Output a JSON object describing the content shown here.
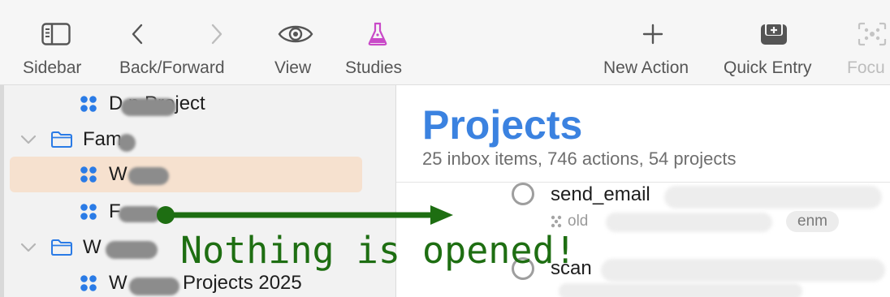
{
  "toolbar": {
    "items": [
      {
        "label": "Sidebar",
        "icon": "sidebar-icon"
      },
      {
        "label": "Back/Forward",
        "icon": "chevron-left-right-icon"
      },
      {
        "label": "View",
        "icon": "eye-icon"
      },
      {
        "label": "Studies",
        "icon": "flask-icon"
      },
      {
        "label": "New Action",
        "icon": "plus-icon"
      },
      {
        "label": "Quick Entry",
        "icon": "inbox-icon"
      },
      {
        "label": "Focu",
        "icon": "focus-icon"
      }
    ]
  },
  "sidebar": {
    "items": [
      {
        "label": "D      n Project",
        "type": "project"
      },
      {
        "label": "Fam",
        "type": "folder"
      },
      {
        "label": "W",
        "type": "project",
        "selected": true
      },
      {
        "label": "F",
        "type": "project"
      },
      {
        "label": "W",
        "type": "folder"
      },
      {
        "label": "Projects 2025",
        "prefix": "W",
        "type": "project"
      }
    ]
  },
  "main": {
    "title": "Projects",
    "subtitle": "25 inbox items, 746 actions, 54 projects",
    "actions": [
      {
        "title": "send_email",
        "meta": "old",
        "tag": "enm"
      },
      {
        "title": "scan",
        "meta": ""
      }
    ]
  },
  "annotation": {
    "text": "Nothing is opened!",
    "color": "#1e6e12"
  },
  "colors": {
    "accent": "#3b82e0",
    "project_icon": "#2a7be6",
    "selected_row": "#f6e1cf",
    "studies_icon": "#c94ac8"
  }
}
